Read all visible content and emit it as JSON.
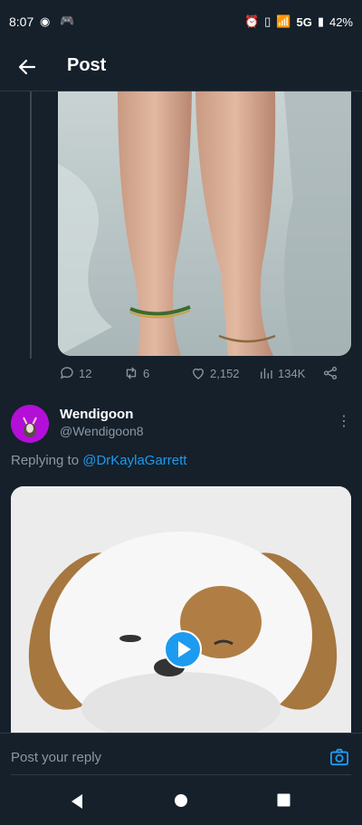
{
  "status_bar": {
    "time": "8:07",
    "network": "5G",
    "battery": "42%",
    "icons": [
      "record-icon",
      "discord-icon",
      "alarm-icon",
      "vibrate-icon",
      "signal-icon",
      "battery-icon"
    ]
  },
  "header": {
    "title": "Post"
  },
  "tweet_actions": {
    "replies": "12",
    "retweets": "6",
    "likes": "2,152",
    "views": "134K"
  },
  "reply": {
    "author_name": "Wendigoon",
    "author_handle": "@Wendigoon8",
    "replying_prefix": "Replying to",
    "replying_to": "@DrKaylaGarrett"
  },
  "composer": {
    "placeholder": "Post your reply"
  },
  "colors": {
    "accent": "#1d9bf0",
    "background": "#15202b",
    "avatar_bg": "#b40fd8"
  }
}
